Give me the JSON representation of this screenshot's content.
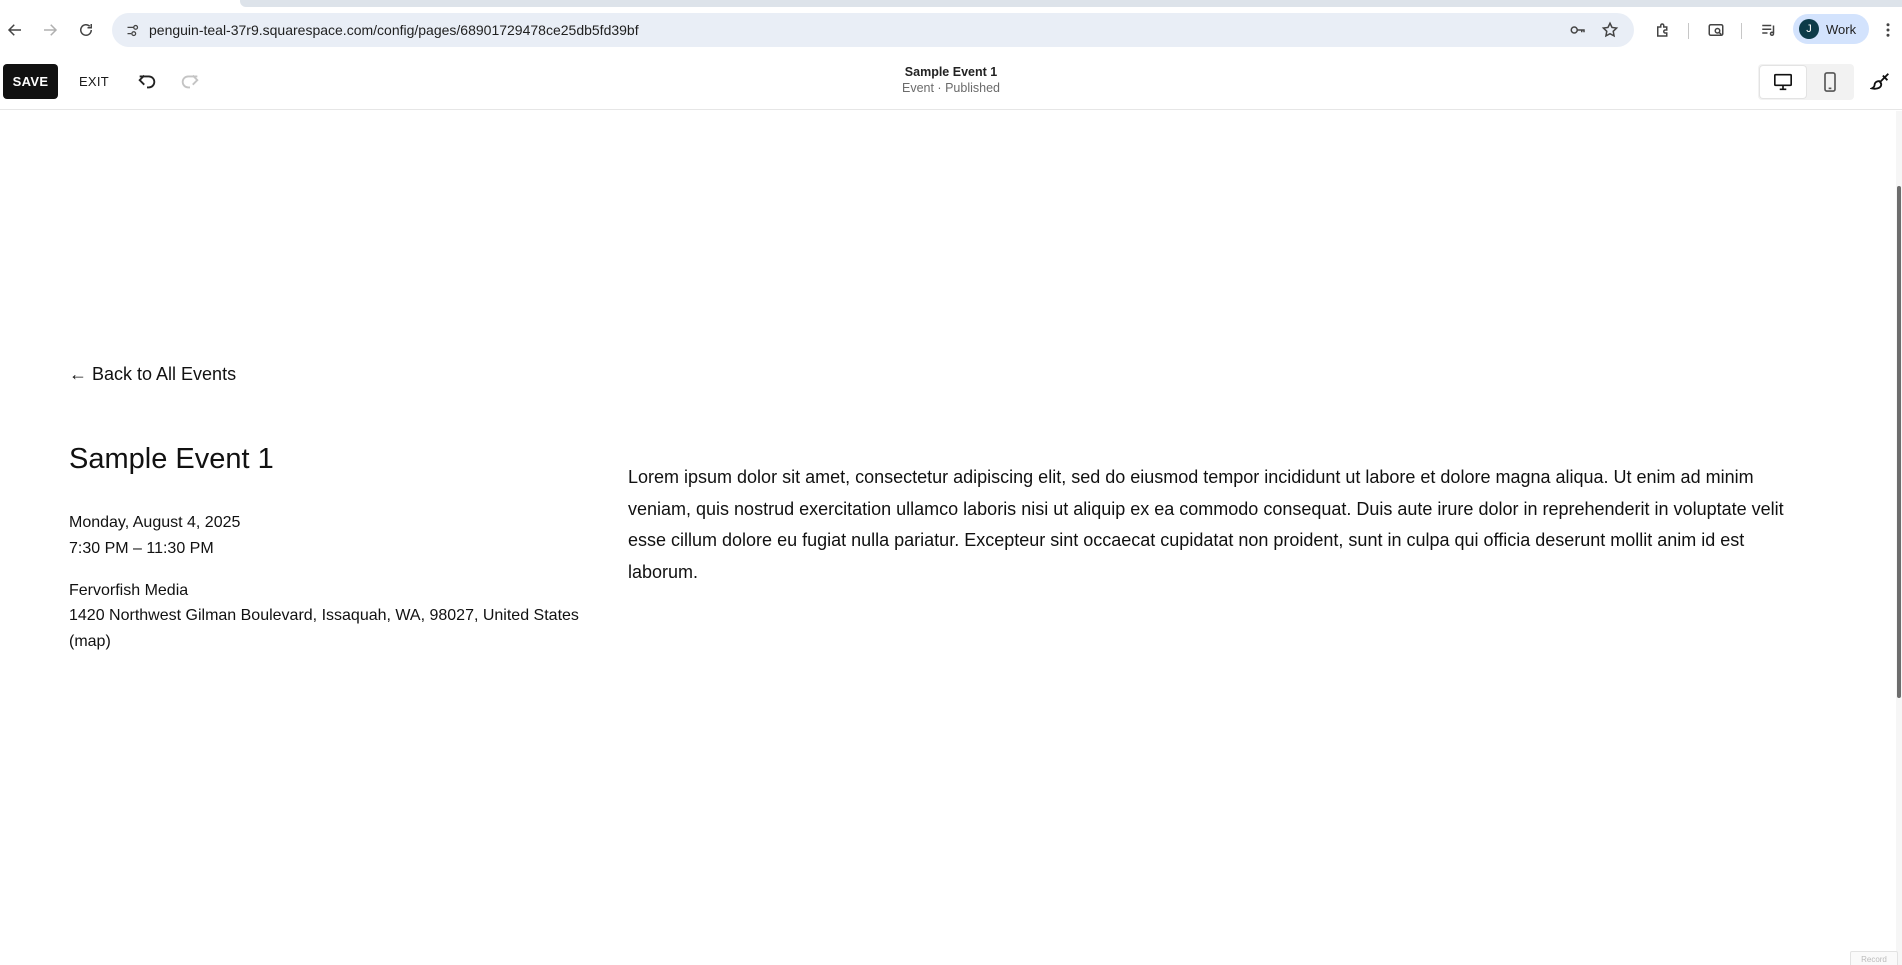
{
  "browser": {
    "url": "penguin-teal-37r9.squarespace.com/config/pages/68901729478ce25db5fd39bf",
    "profile_initial": "J",
    "profile_label": "Work",
    "icons": [
      "back-arrow-icon",
      "forward-arrow-icon",
      "reload-icon",
      "site-info-icon",
      "password-key-icon",
      "bookmark-star-icon",
      "extensions-puzzle-icon",
      "tab-search-icon",
      "media-controls-icon",
      "kebab-menu-icon"
    ]
  },
  "editor_toolbar": {
    "save_label": "SAVE",
    "exit_label": "EXIT",
    "page_name": "Sample Event 1",
    "page_status": "Event · Published",
    "icons": [
      "undo-icon",
      "redo-icon",
      "desktop-icon",
      "mobile-icon",
      "paintbrush-icon"
    ]
  },
  "event": {
    "back_link": "← Back to All Events",
    "title": "Sample Event 1",
    "date": "Monday, August 4, 2025",
    "time": "7:30 PM – 11:30 PM",
    "venue": "Fervorfish Media",
    "address": "1420 Northwest Gilman Boulevard, Issaquah, WA, 98027, United States",
    "map_link": "(map)",
    "description": "Lorem ipsum dolor sit amet, consectetur adipiscing elit, sed do eiusmod tempor incididunt ut labore et dolore magna aliqua. Ut enim ad minim veniam, quis nostrud exercitation ullamco laboris nisi ut aliquip ex ea commodo consequat. Duis aute irure dolor in reprehenderit in voluptate velit esse cillum dolore eu fugiat nulla pariatur. Excepteur sint occaecat cupidatat non proident, sunt in culpa qui officia deserunt mollit anim id est laborum."
  },
  "corner_badge": "Record",
  "colors": {
    "save_button_bg": "#111111",
    "omnibox_bg": "#e9eef6",
    "profile_chip_bg": "#d3e3fd",
    "avatar_bg": "#0d3b49",
    "redo_disabled": "#c4c4c4"
  }
}
